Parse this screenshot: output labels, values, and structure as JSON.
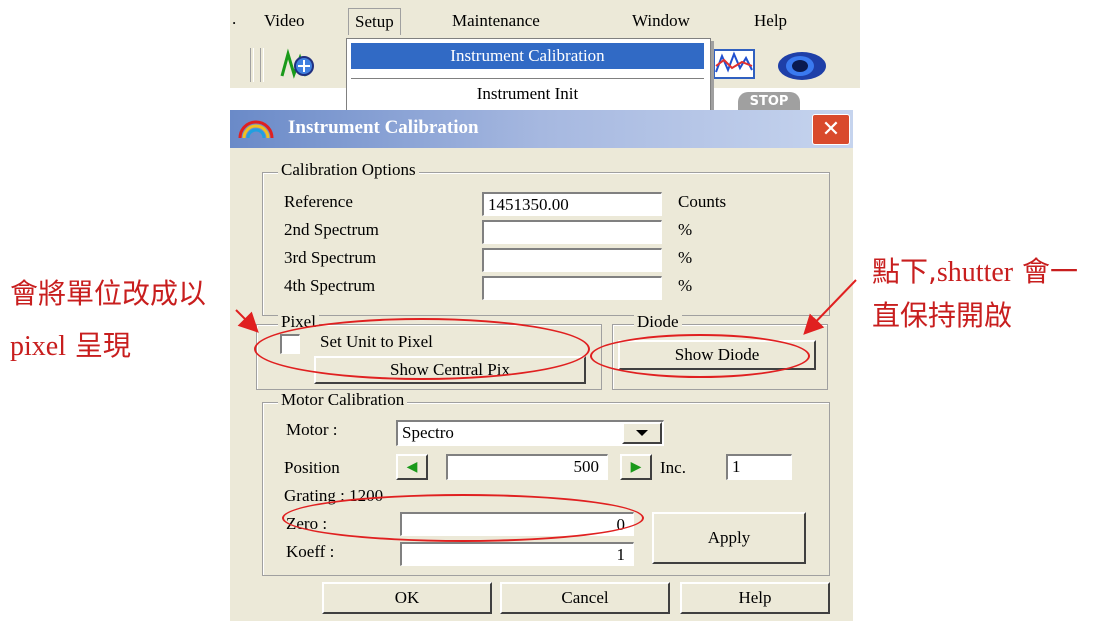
{
  "menubar": {
    "items": [
      "Video",
      "Setup",
      "Maintenance",
      "Window",
      "Help"
    ]
  },
  "setup_menu": {
    "items": [
      "Instrument Calibration",
      "Instrument Init"
    ]
  },
  "toolbar": {
    "stop_label": "STOP"
  },
  "dialog": {
    "title": "Instrument Calibration",
    "close_symbol": "✕",
    "calibration_options": {
      "title": "Calibration Options",
      "rows": [
        {
          "label": "Reference",
          "value": "1451350.00",
          "unit": "Counts"
        },
        {
          "label": "2nd Spectrum",
          "value": "",
          "unit": "%"
        },
        {
          "label": "3rd Spectrum",
          "value": "",
          "unit": "%"
        },
        {
          "label": "4th Spectrum",
          "value": "",
          "unit": "%"
        }
      ]
    },
    "pixel": {
      "title": "Pixel",
      "checkbox_label": "Set Unit to Pixel",
      "button_label": "Show Central Pix"
    },
    "diode": {
      "title": "Diode",
      "button_label": "Show Diode"
    },
    "motor": {
      "title": "Motor Calibration",
      "motor_label": "Motor :",
      "motor_value": "Spectro",
      "position_label": "Position",
      "position_value": "500",
      "inc_label": "Inc.",
      "inc_value": "1",
      "grating_label": "Grating : 1200",
      "zero_label": "Zero :",
      "zero_value": "0",
      "koeff_label": "Koeff :",
      "koeff_value": "1",
      "apply_label": "Apply"
    },
    "buttons": {
      "ok": "OK",
      "cancel": "Cancel",
      "help": "Help"
    }
  },
  "annotations": {
    "left_line1": "會將單位改成以",
    "left_line2_prefix": "pixel",
    "left_line2_suffix": " 呈現",
    "right_line1_prefix": "點下,",
    "right_line1_mid": "shutter",
    "right_line1_suffix": " 會一",
    "right_line2": "直保持開啟"
  },
  "colors": {
    "annotation_red": "#c81e1e",
    "highlight_blue": "#316ac5",
    "arrow_green": "#1a9a1a"
  }
}
